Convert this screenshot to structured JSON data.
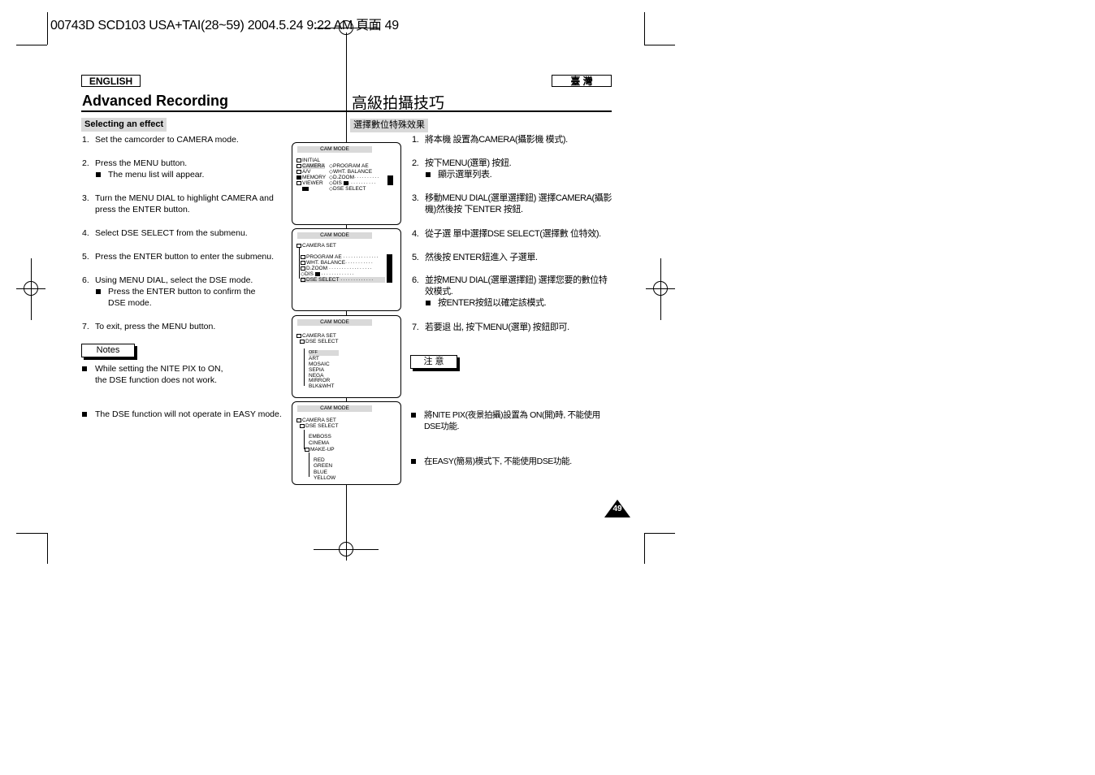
{
  "slug": "00743D SCD103 USA+TAI(28~59)  2004.5.24  9:22 AM  頁面 49",
  "left": {
    "language": "ENGLISH",
    "title": "Advanced Recording",
    "section": "Selecting an effect",
    "steps": [
      {
        "n": "1.",
        "text": "Set the camcorder to CAMERA mode."
      },
      {
        "n": "2.",
        "text": "Press the MENU button.",
        "bullet": "The menu list will appear."
      },
      {
        "n": "3.",
        "text": "Turn the MENU DIAL to highlight CAMERA and press the ENTER button."
      },
      {
        "n": "4.",
        "text": "Select DSE SELECT from the submenu."
      },
      {
        "n": "5.",
        "text": "Press the ENTER button to enter the submenu."
      },
      {
        "n": "6.",
        "text": "Using MENU DIAL, select the DSE mode.",
        "bullet": "Press the ENTER button to confirm the DSE mode."
      },
      {
        "n": "7.",
        "text": "To exit, press the MENU button."
      }
    ],
    "notes_label": "Notes",
    "notes": [
      "While setting the NITE PIX to ON, the DSE function does not work.",
      "The DSE function will not operate in EASY mode."
    ]
  },
  "right": {
    "language": "臺 灣",
    "title": "高級拍攝技巧",
    "section": "選擇數位特殊效果",
    "steps": [
      {
        "n": "1.",
        "text": "將本機 設置為CAMERA(攝影機 模式)."
      },
      {
        "n": "2.",
        "text": "按下MENU(選單) 按鈕.",
        "bullet": "顯示選單列表."
      },
      {
        "n": "3.",
        "text": "移動MENU DIAL(選單選擇鈕) 選擇CAMERA(攝影機)然後按 下ENTER 按鈕."
      },
      {
        "n": "4.",
        "text": "從子選 單中選擇DSE SELECT(選擇數 位特效)."
      },
      {
        "n": "5.",
        "text": "然後按 ENTER鈕進入 子選單."
      },
      {
        "n": "6.",
        "text": "並按MENU DIAL(選單選擇鈕) 選擇您要的數位特效模式.",
        "bullet": "按ENTER按鈕以確定該模式."
      },
      {
        "n": "7.",
        "text": "若要退 出, 按下MENU(選單) 按鈕即可."
      }
    ],
    "notes_label": "注 意",
    "notes": [
      "將NITE PIX(夜景拍攝)設置為 ON(開)時, 不能使用DSE功能.",
      "在EASY(簡易)模式下, 不能使用DSE功能."
    ]
  },
  "screens": [
    {
      "title": "CAM MODE",
      "menu": [
        "INITIAL",
        "CAMERA",
        "A/V",
        "MEMORY",
        "VIEWER"
      ],
      "submenu": [
        "PROGRAM AE",
        "WHT. BALANCE",
        "D.ZOOM",
        "DIS",
        "DSE SELECT"
      ]
    },
    {
      "title": "CAM MODE",
      "header": "CAMERA SET",
      "items": [
        "PROGRAM AE",
        "WHT. BALANCE",
        "D.ZOOM",
        "DIS",
        "DSE SELECT"
      ]
    },
    {
      "title": "CAM MODE",
      "header": "CAMERA SET",
      "sub": "DSE SELECT",
      "items": [
        "OFF",
        "ART",
        "MOSAIC",
        "SEPIA",
        "NEGA",
        "MIRROR",
        "BLK&WHT"
      ]
    },
    {
      "title": "CAM MODE",
      "header": "CAMERA SET",
      "sub": "DSE SELECT",
      "items": [
        "EMBOSS",
        "CINEMA",
        "MAKE-UP"
      ],
      "makeup": [
        "RED",
        "GREEN",
        "BLUE",
        "YELLOW"
      ]
    }
  ],
  "page_number": "49"
}
